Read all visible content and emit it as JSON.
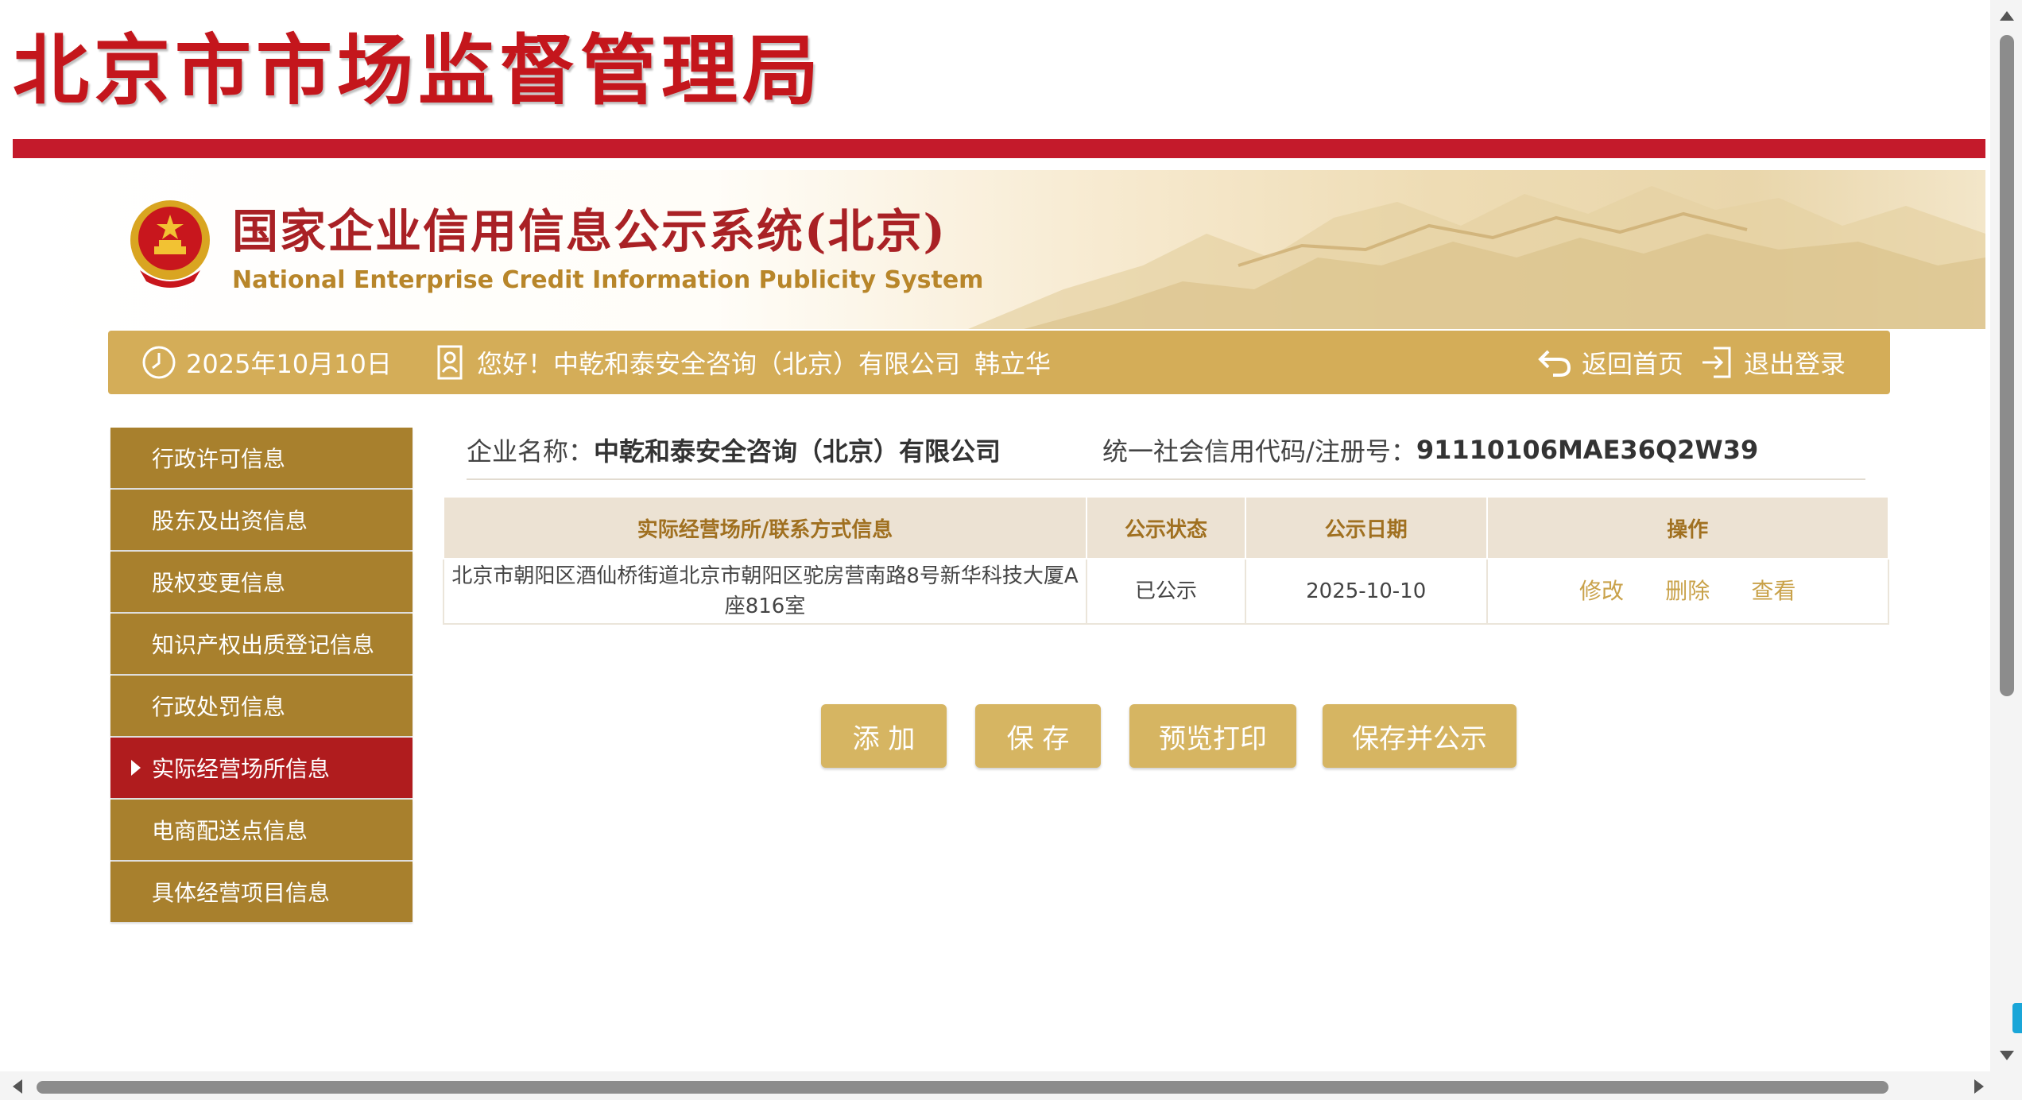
{
  "header": {
    "agency_title": "北京市市场监督管理局",
    "system_title_cn": "国家企业信用信息公示系统(北京)",
    "system_title_en": "National Enterprise Credit Information Publicity System"
  },
  "infobar": {
    "date": "2025年10月10日",
    "greeting": "您好！中乾和泰安全咨询（北京）有限公司",
    "user_name": "韩立华",
    "home_label": "返回首页",
    "logout_label": "退出登录",
    "date_icon": "clock-icon",
    "user_icon": "id-badge-icon",
    "home_icon": "return-arrow-icon",
    "logout_icon": "logout-icon"
  },
  "sidebar": {
    "items": [
      {
        "label": "行政许可信息",
        "active": false
      },
      {
        "label": "股东及出资信息",
        "active": false
      },
      {
        "label": "股权变更信息",
        "active": false
      },
      {
        "label": "知识产权出质登记信息",
        "active": false
      },
      {
        "label": "行政处罚信息",
        "active": false
      },
      {
        "label": "实际经营场所信息",
        "active": true
      },
      {
        "label": "电商配送点信息",
        "active": false
      },
      {
        "label": "具体经营项目信息",
        "active": false
      }
    ]
  },
  "company": {
    "name_label": "企业名称：",
    "name": "中乾和泰安全咨询（北京）有限公司",
    "code_label": "统一社会信用代码/注册号：",
    "code": "91110106MAE36Q2W39"
  },
  "table": {
    "headers": [
      "实际经营场所/联系方式信息",
      "公示状态",
      "公示日期",
      "操作"
    ],
    "rows": [
      {
        "address": "北京市朝阳区酒仙桥街道北京市朝阳区驼房营南路8号新华科技大厦A座816室",
        "status": "已公示",
        "date": "2025-10-10",
        "actions": [
          "修改",
          "删除",
          "查看"
        ]
      }
    ]
  },
  "buttons": {
    "add": "添 加",
    "save": "保 存",
    "preview_print": "预览打印",
    "save_publish": "保存并公示"
  },
  "colors": {
    "agency_red": "#c4161c",
    "gold": "#d4ad58",
    "sidebar_gold": "#a8802d",
    "active_red": "#b01c1e",
    "link_gold": "#c9a24a"
  }
}
